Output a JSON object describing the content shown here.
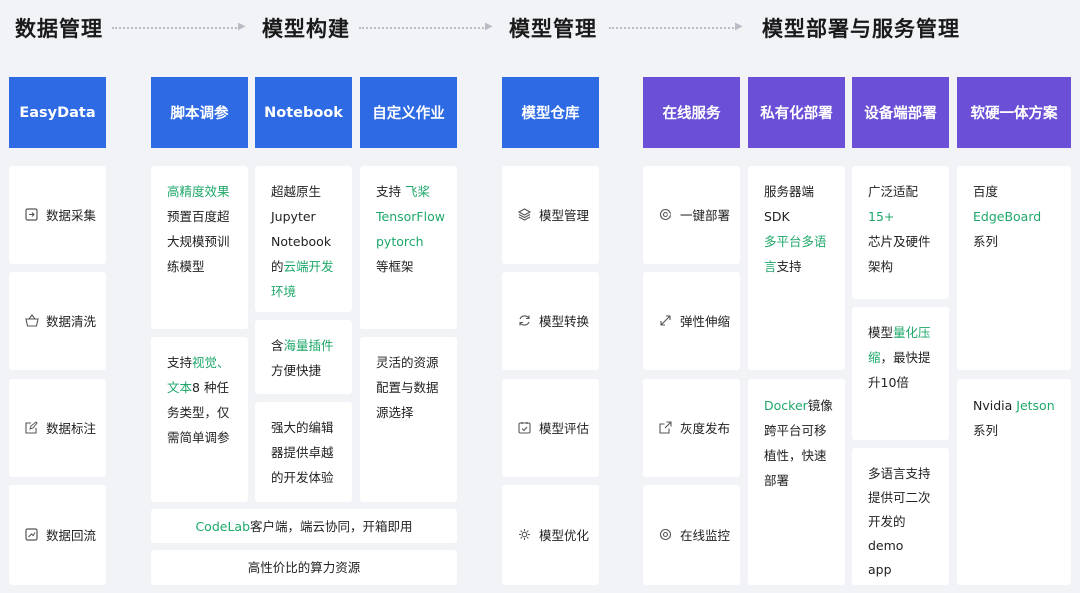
{
  "headers": {
    "data_mgmt": "数据管理",
    "model_build": "模型构建",
    "model_mgmt": "模型管理",
    "deploy": "模型部署与服务管理"
  },
  "tiles": {
    "easydata": "EasyData",
    "script": "脚本调参",
    "notebook": "Notebook",
    "custom_job": "自定义作业",
    "model_repo": "模型仓库",
    "online_service": "在线服务",
    "private_deploy": "私有化部署",
    "device_deploy": "设备端部署",
    "hw_sw": "软硬一体方案"
  },
  "data_items": [
    "数据采集",
    "数据清洗",
    "数据标注",
    "数据回流"
  ],
  "model_items": [
    "模型管理",
    "模型转换",
    "模型评估",
    "模型优化"
  ],
  "service_items": [
    "一键部署",
    "弹性伸缩",
    "灰度发布",
    "在线监控"
  ],
  "script": {
    "card1": {
      "h1": "高精度效果",
      "t1": "预置百度超",
      "t2": "大规模预训",
      "t3": "练模型"
    },
    "card2": {
      "p1": "支持",
      "h1": "视觉、",
      "h2": "文本",
      "p2": "8 种任",
      "t2": "务类型，仅",
      "t3": "需简单调参"
    }
  },
  "notebook": {
    "card1": {
      "t1": "超越原生",
      "t2": "Jupyter",
      "t3": "Notebook",
      "p4": "的",
      "h4": "云端开发",
      "h5": "环境"
    },
    "card2": {
      "p1": "含",
      "h1": "海量插件",
      "t2": "方便快捷"
    },
    "card3": {
      "t1": "强大的编辑",
      "t2": "器提供卓越",
      "t3": "的开发体验"
    }
  },
  "custom_job": {
    "card1": {
      "p1": "支持 ",
      "h1": "飞桨",
      "h2": "TensorFlow",
      "h3": "pytorch",
      "t4": "等框架"
    },
    "card2": {
      "t1": "灵活的资源",
      "t2": "配置与数据",
      "t3": "源选择"
    }
  },
  "codelab": {
    "h": "CodeLab",
    "t": "客户端，端云协同，开箱即用"
  },
  "compute": "高性价比的算力资源",
  "private": {
    "card1": {
      "t1": "服务器端SDK",
      "h2": "多平台多语",
      "h3": "言",
      "p3": "支持"
    },
    "card2": {
      "h1": "Docker",
      "p1": "镜像",
      "t2": "跨平台可移",
      "t3": "植性，快速",
      "t4": "部署"
    }
  },
  "device": {
    "card1": {
      "p1": "广泛适配",
      "h1": "15+",
      "t2": "芯片及硬件",
      "t3": "架构"
    },
    "card2": {
      "p1": "模型",
      "h1": "量化压",
      "h2": "缩",
      "p2": "，最快提",
      "t3": "升10倍"
    },
    "card3": {
      "t1": "多语言支持",
      "t2": "提供可二次",
      "t3": "开发的demo",
      "t4": "app"
    }
  },
  "hwsw": {
    "card1": {
      "p1": "百度",
      "h1": "EdgeBoard",
      "t2": "系列"
    },
    "card2": {
      "p1": "Nvidia ",
      "h1": "Jetson",
      "t2": "系列"
    }
  },
  "colors": {
    "blue": "#2d6ae3",
    "purple": "#6b4fd6",
    "green": "#1fa86a"
  }
}
